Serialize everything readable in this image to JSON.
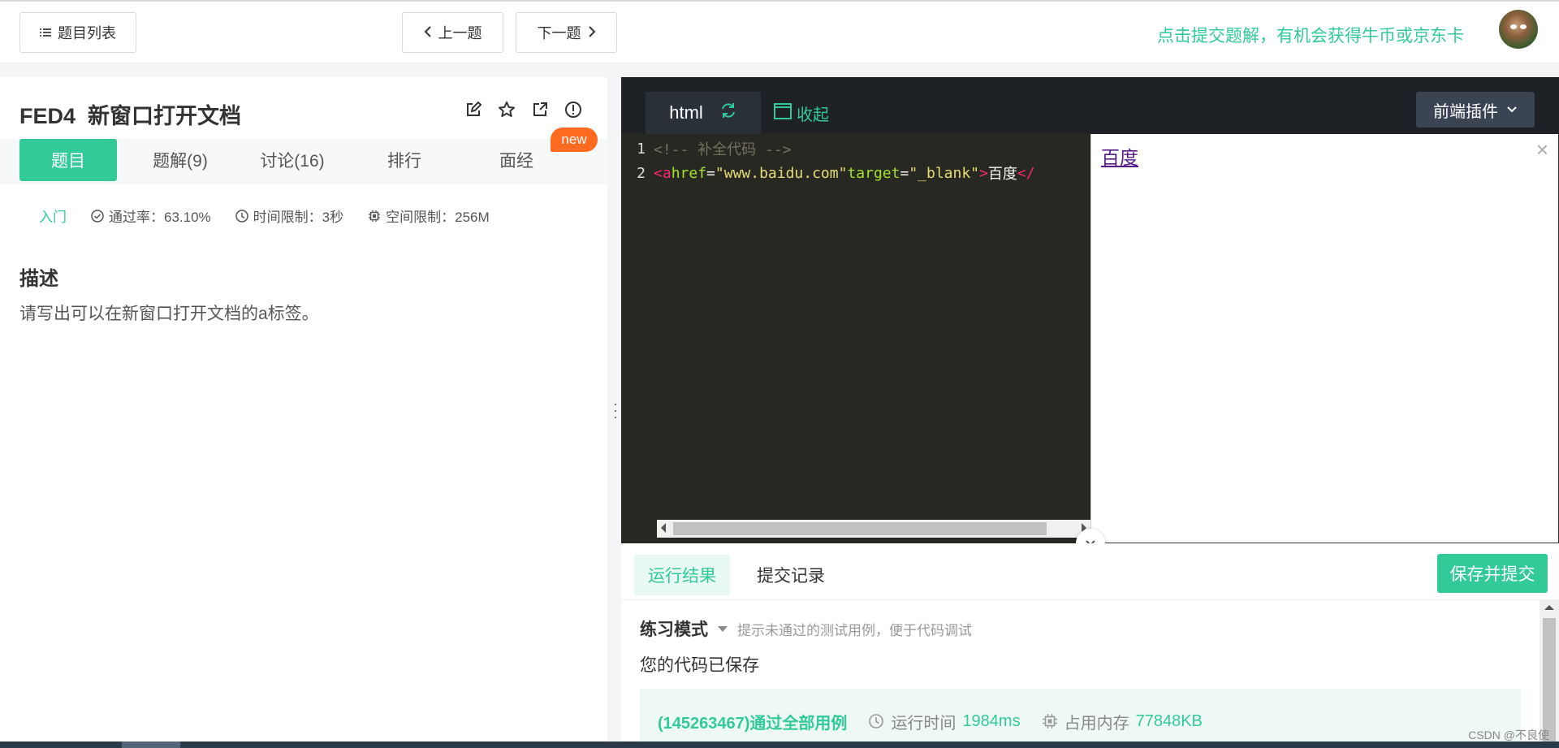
{
  "topbar": {
    "list_label": "题目列表",
    "prev_label": "上一题",
    "next_label": "下一题",
    "promo": "点击提交题解，有机会获得牛币或京东卡"
  },
  "question": {
    "id": "FED4",
    "title": "新窗口打开文档",
    "new_badge": "new",
    "tabs": [
      {
        "label": "题目"
      },
      {
        "label": "题解(9)"
      },
      {
        "label": "讨论(16)"
      },
      {
        "label": "排行"
      },
      {
        "label": "面经"
      }
    ],
    "level": "入门",
    "pass_rate": "通过率：63.10%",
    "time_limit": "时间限制：3秒",
    "memory_limit": "空间限制：256M",
    "desc_heading": "描述",
    "desc_text": "请写出可以在新窗口打开文档的a标签。"
  },
  "editor": {
    "language": "html",
    "collapse_label": "收起",
    "plugin_label": "前端插件",
    "lines": [
      {
        "num": "1",
        "comment": "<!-- 补全代码 -->"
      },
      {
        "num": "2",
        "tag_open": "<a",
        "attr1": " href",
        "eq1": "=",
        "val1": "\"www.baidu.com\"",
        "attr2": " target",
        "eq2": "=",
        "val2": "\"_blank\"",
        "gt": ">",
        "text": "百度",
        "close": "</"
      }
    ],
    "preview_link": "百度",
    "preview_close": "×"
  },
  "result": {
    "tab_result": "运行结果",
    "tab_history": "提交记录",
    "submit_label": "保存并提交",
    "mode_label": "练习模式",
    "mode_hint": "提示未通过的测试用例，便于代码调试",
    "saved_msg": "您的代码已保存",
    "pass_text": "(145263467)通过全部用例",
    "runtime_label": "运行时间",
    "runtime_value": "1984ms",
    "memory_label": "占用内存",
    "memory_value": "77848KB"
  },
  "watermark": "CSDN @不良使",
  "colors": {
    "accent": "#32ca99",
    "badge": "#ff6a21",
    "editor_bg": "#272822"
  }
}
